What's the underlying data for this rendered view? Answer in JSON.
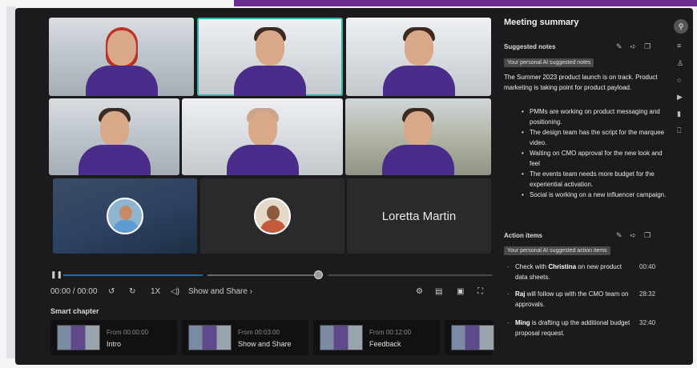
{
  "participants": {
    "placeholder_name": "Loretta Martin"
  },
  "playback": {
    "pause_icon": "pause-icon",
    "time": "00:00 / 00:00",
    "speed": "1X",
    "show_and_share": "Show and Share",
    "progress": 0.6
  },
  "chapters": {
    "title": "Smart chapter",
    "items": [
      {
        "from": "From 00:00:00",
        "title": "Intro"
      },
      {
        "from": "From 00:03:00",
        "title": "Show and Share"
      },
      {
        "from": "From 00:12:00",
        "title": "Feedback"
      }
    ]
  },
  "summary": {
    "title": "Meeting summary",
    "notes_title": "Suggested notes",
    "notes_chip": "Your personal AI suggested notes",
    "intro_text": "The Summer 2023 product launch is on track. Product marketing is taking point for product payload.",
    "bullets": [
      "PMMs are working on product messaging and positioning.",
      "The design team has the script for the marquee video.",
      "Waiting on CMO approval for the new look and feel",
      "The events team needs more budget for the experiential activation.",
      "Social is working on a new influencer campaign."
    ],
    "actions_title": "Action items",
    "actions_chip": "Your personal AI suggested action items",
    "actions": [
      {
        "pre": "Check with ",
        "bold": "Christina",
        "post": " on new product data sheets.",
        "time": "00:40"
      },
      {
        "pre": "",
        "bold": "Raj",
        "post": " will follow up with the CMO team on approvals.",
        "time": "28:32"
      },
      {
        "pre": "",
        "bold": "Ming",
        "post": " is drafting up the additional budget proposal request.",
        "time": "32:40"
      }
    ]
  },
  "colors": {
    "accent_teal": "#2bb8a8",
    "brand_purple": "#6b2c8f",
    "progress_blue": "#2a6aa8"
  }
}
